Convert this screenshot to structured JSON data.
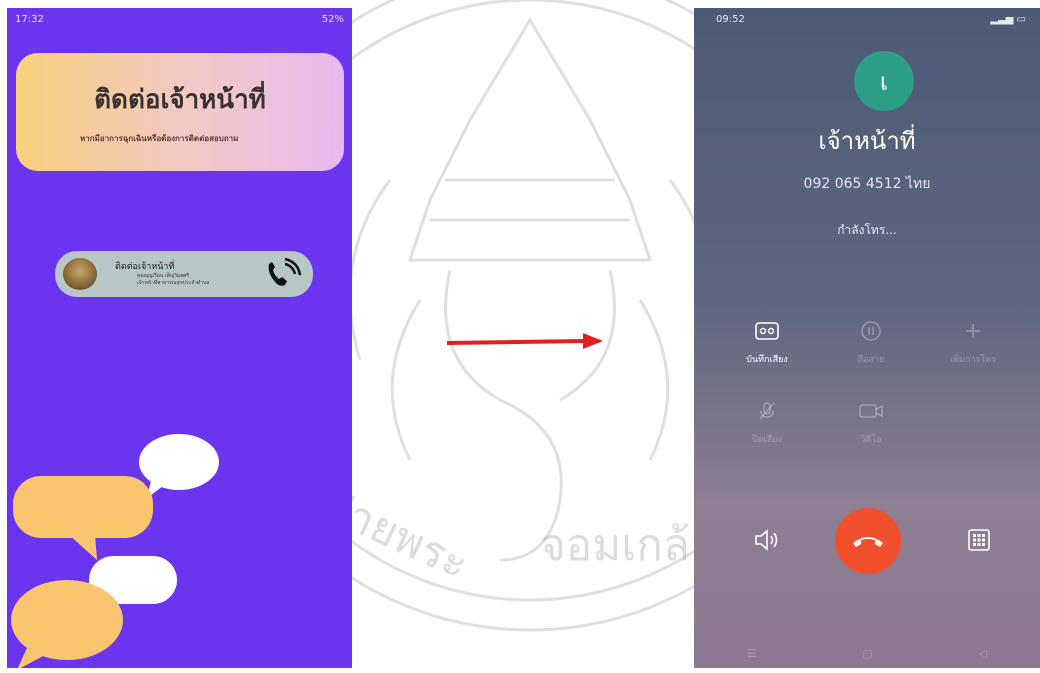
{
  "left_screen": {
    "status_time": "17:32",
    "status_right": "52%",
    "title": "ติดต่อเจ้าหน้าที่",
    "subtitle": "หากมีอาการฉุกเฉินหรือต้องการติดต่อสอบถาม",
    "contact": {
      "name": "ติดต่อเจ้าหน้าที่",
      "line1": "คุณบุญเรือน เพ็ญวิมลศรี",
      "line2": "เจ้าหน้าที่สาธารณสุขประจำตำบล"
    },
    "background_color": "#6b35f0"
  },
  "right_screen": {
    "status_time": "09:52",
    "caller_initial": "เ",
    "caller_name": "เจ้าหน้าที่",
    "caller_number": "092 065 4512  ไทย",
    "call_status": "กำลังโทร...",
    "controls": [
      {
        "label": "บันทึกเสียง",
        "icon": "record-icon",
        "active": true
      },
      {
        "label": "ถือสาย",
        "icon": "hold-icon",
        "active": false
      },
      {
        "label": "เพิ่มการโทร",
        "icon": "add-call-icon",
        "active": false
      },
      {
        "label": "ปิดเสียง",
        "icon": "mute-icon",
        "active": false
      },
      {
        "label": "วิดีโอ",
        "icon": "video-icon",
        "active": false
      }
    ],
    "end_call_color": "#f2502c",
    "avatar_color": "#2c9e86"
  },
  "watermark_text": "จอมเกล้าเจ้าคุณทหาร",
  "arrow_color": "#e31e1e"
}
